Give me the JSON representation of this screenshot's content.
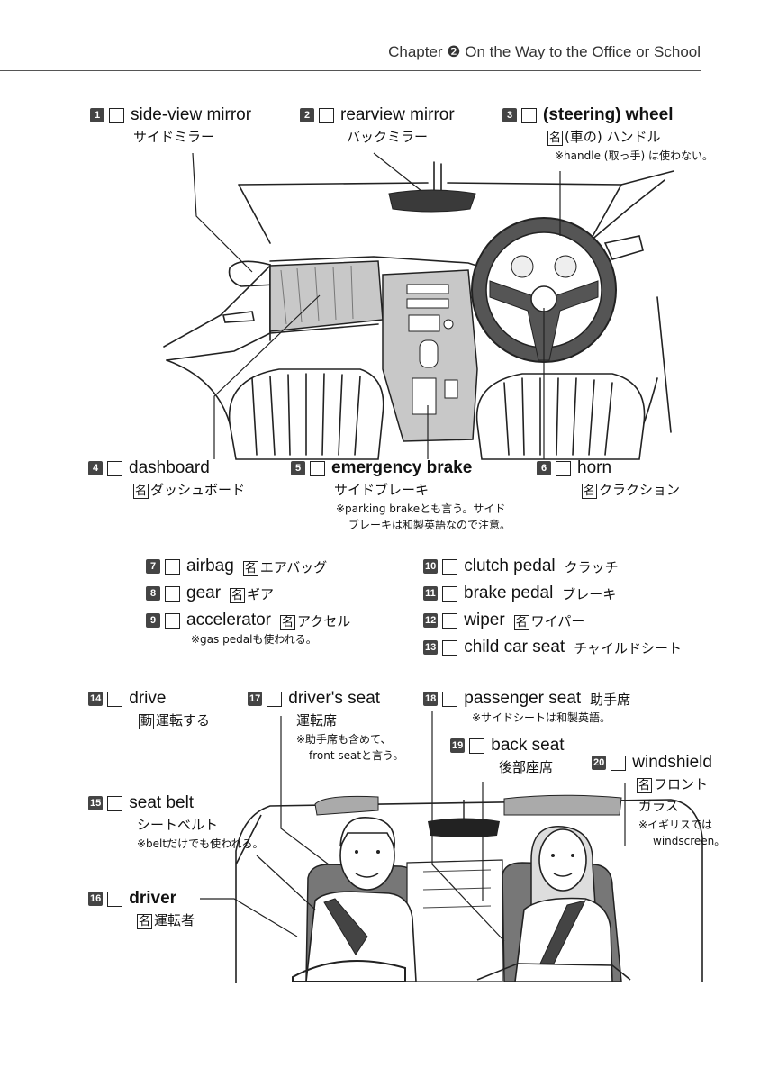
{
  "header": {
    "chapter": "Chapter ❷ On the Way to the Office or School"
  },
  "badge_noun": "名",
  "badge_verb": "動",
  "entries": {
    "e1": {
      "num": "1",
      "term": "side-view mirror",
      "jp": "サイドミラー"
    },
    "e2": {
      "num": "2",
      "term": "rearview mirror",
      "jp": "バックミラー"
    },
    "e3": {
      "num": "3",
      "term_a": "(steering)",
      "term_b": "wheel",
      "jp": "(車の) ハンドル",
      "note": "※handle (取っ手) は使わない。"
    },
    "e4": {
      "num": "4",
      "term": "dashboard",
      "jp": "ダッシュボード"
    },
    "e5": {
      "num": "5",
      "term": "emergency brake",
      "jp": "サイドブレーキ",
      "note1": "※parking brakeとも言う。サイド",
      "note2": "ブレーキは和製英語なので注意。"
    },
    "e6": {
      "num": "6",
      "term": "horn",
      "jp": "クラクション"
    },
    "e7": {
      "num": "7",
      "term": "airbag",
      "jp": "エアバッグ"
    },
    "e8": {
      "num": "8",
      "term": "gear",
      "jp": "ギア"
    },
    "e9": {
      "num": "9",
      "term": "accelerator",
      "jp": "アクセル",
      "note": "※gas pedalも使われる。"
    },
    "e10": {
      "num": "10",
      "term": "clutch pedal",
      "jp": "クラッチ"
    },
    "e11": {
      "num": "11",
      "term": "brake pedal",
      "jp": "ブレーキ"
    },
    "e12": {
      "num": "12",
      "term": "wiper",
      "jp": "ワイパー"
    },
    "e13": {
      "num": "13",
      "term": "child car seat",
      "jp": "チャイルドシート"
    },
    "e14": {
      "num": "14",
      "term": "drive",
      "jp": "運転する"
    },
    "e15": {
      "num": "15",
      "term": "seat belt",
      "jp": "シートベルト",
      "note": "※beltだけでも使われる。"
    },
    "e16": {
      "num": "16",
      "term": "driver",
      "jp": "運転者"
    },
    "e17": {
      "num": "17",
      "term": "driver's seat",
      "jp": "運転席",
      "note1": "※助手席も含めて、",
      "note2": "front seatと言う。"
    },
    "e18": {
      "num": "18",
      "term": "passenger seat",
      "jp": "助手席",
      "note": "※サイドシートは和製英語。"
    },
    "e19": {
      "num": "19",
      "term": "back seat",
      "jp": "後部座席"
    },
    "e20": {
      "num": "20",
      "term": "windshield",
      "jp1": "フロント",
      "jp2": "ガラス",
      "note1": "※イギリスでは",
      "note2": "windscreen。"
    }
  }
}
